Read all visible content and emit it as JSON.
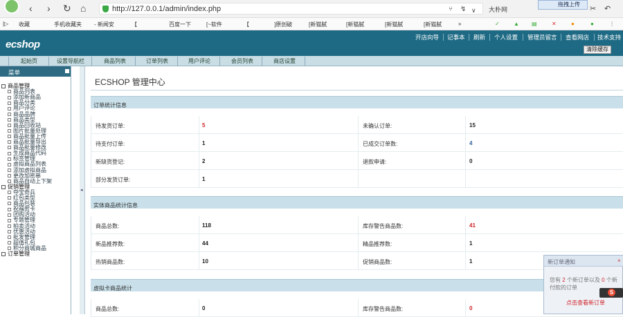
{
  "browser": {
    "url": "http://127.0.0.1/admin/index.php",
    "search_hint": "大朴网",
    "upload_button": "拖拽上传",
    "bookmarks": [
      "收藏",
      "手机收藏夹",
      "- 新闻安",
      "【",
      "百度一下",
      "[~软件",
      "【",
      "]原创破",
      "[新猫腻",
      "[新猫腻",
      "[新猫腻",
      "[新猫腻",
      "»"
    ]
  },
  "header": {
    "logo": "ecshop",
    "top_links": [
      "开店向导",
      "记事本",
      "刷新",
      "个人设置",
      "管理员留言",
      "查看网店",
      "技术支持"
    ],
    "clear_cache": "清除缓存"
  },
  "tabs": [
    "起始页",
    "设置导航栏",
    "商品列表",
    "订单列表",
    "用户评论",
    "会员列表",
    "商店设置"
  ],
  "sidebar": {
    "title": "菜单",
    "groups": [
      {
        "name": "商品管理",
        "items": [
          "商品列表",
          "添加新商品",
          "商品分类",
          "用户评论",
          "商品品牌",
          "商品类型",
          "商品回收站",
          "图片批量处理",
          "商品批量上传",
          "商品批量导出",
          "商品批量修改",
          "生成商品代码",
          "标签管理",
          "虚拟商品列表",
          "添加虚拟商品",
          "更改加密串",
          "商品自动上下架"
        ]
      },
      {
        "name": "促销管理",
        "items": [
          "夺宝奇兵",
          "红包类型",
          "商品包装",
          "祝福贺卡",
          "团购活动",
          "专题管理",
          "拍卖活动",
          "优惠活动",
          "批发管理",
          "超值礼包",
          "积分商城商品"
        ]
      },
      {
        "name": "订单管理",
        "items": []
      }
    ]
  },
  "main": {
    "title": "ECSHOP 管理中心",
    "order_stats": {
      "title": "订单统计信息",
      "rows": [
        {
          "l1": "待发货订单:",
          "v1": "5",
          "l2": "未确认订单:",
          "v2": "15"
        },
        {
          "l1": "待支付订单:",
          "v1": "1",
          "l2": "已成交订单数:",
          "v2": "4"
        },
        {
          "l1": "新缺货登记:",
          "v1": "2",
          "l2": "退款申请:",
          "v2": "0"
        },
        {
          "l1": "部分发货订单:",
          "v1": "1",
          "l2": "",
          "v2": ""
        }
      ]
    },
    "goods_stats": {
      "title": "实体商品统计信息",
      "rows": [
        {
          "l1": "商品总数:",
          "v1": "118",
          "l2": "库存警告商品数:",
          "v2": "41"
        },
        {
          "l1": "新品推荐数:",
          "v1": "44",
          "l2": "精品推荐数:",
          "v2": "1"
        },
        {
          "l1": "热销商品数:",
          "v1": "10",
          "l2": "促销商品数:",
          "v2": "1"
        }
      ]
    },
    "virtual_stats": {
      "title": "虚拟卡商品统计",
      "rows": [
        {
          "l1": "商品总数:",
          "v1": "0",
          "l2": "库存警告商品数:",
          "v2": "0"
        }
      ]
    }
  },
  "notice": {
    "title": "新订单通知",
    "close": "×",
    "msg_a": "您有 ",
    "new_orders": "2",
    "msg_b": " 个新订单以及 ",
    "new_paid": "0",
    "msg_c": " 个新付款的订单",
    "link": "点击查看新订单"
  },
  "colors": {
    "header": "#1e6a84",
    "panel": "#c9e0ea",
    "highlight": "#d0242a",
    "link_blue": "#2c5f9a"
  }
}
